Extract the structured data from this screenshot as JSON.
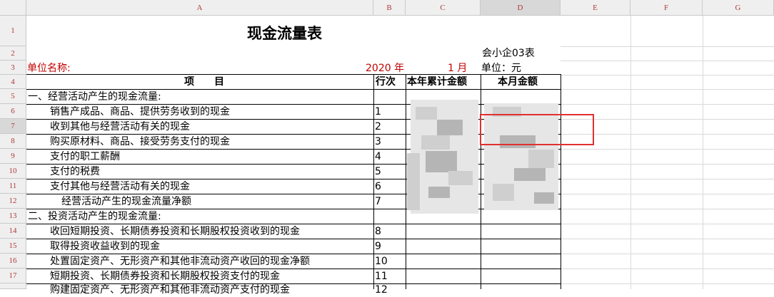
{
  "columns": [
    "A",
    "B",
    "C",
    "D",
    "E",
    "F",
    "G"
  ],
  "rows": [
    "1",
    "2",
    "3",
    "4",
    "5",
    "6",
    "7",
    "8",
    "9",
    "10",
    "11",
    "12",
    "13",
    "14",
    "15",
    "16",
    "17"
  ],
  "sheet": {
    "title": "现金流量表",
    "form_code": "会小企03表",
    "unit_name_label": "单位名称:",
    "year": "2020 年",
    "month": "1 月",
    "unit_label": "单位：元"
  },
  "table_header": {
    "item": "项　　目",
    "line_no": "行次",
    "ytd": "本年累计金额",
    "month": "本月金额"
  },
  "items": [
    {
      "label": "一、经营活动产生的现金流量:",
      "line": ""
    },
    {
      "label": "销售产成品、商品、提供劳务收到的现金",
      "line": "1"
    },
    {
      "label": "收到其他与经营活动有关的现金",
      "line": "2"
    },
    {
      "label": "购买原材料、商品、接受劳务支付的现金",
      "line": "3"
    },
    {
      "label": "支付的职工薪酬",
      "line": "4"
    },
    {
      "label": "支付的税费",
      "line": "5"
    },
    {
      "label": "支付其他与经营活动有关的现金",
      "line": "6"
    },
    {
      "label": "经营活动产生的现金流量净额",
      "line": "7"
    },
    {
      "label": "二、投资活动产生的现金流量:",
      "line": ""
    },
    {
      "label": "收回短期投资、长期债券投资和长期股权投资收到的现金",
      "line": "8"
    },
    {
      "label": "取得投资收益收到的现金",
      "line": "9"
    },
    {
      "label": "处置固定资产、无形资产和其他非流动资产收回的现金净额",
      "line": "10"
    },
    {
      "label": "短期投资、长期债券投资和长期股权投资支付的现金",
      "line": "11"
    },
    {
      "label": "购建固定资产、无形资产和其他非流动资产支付的现金",
      "line": "12"
    }
  ],
  "colors": {
    "header_bg": "#efefef",
    "header_text": "#b23838",
    "highlight": "#e0302e",
    "red_text": "#c00000"
  }
}
